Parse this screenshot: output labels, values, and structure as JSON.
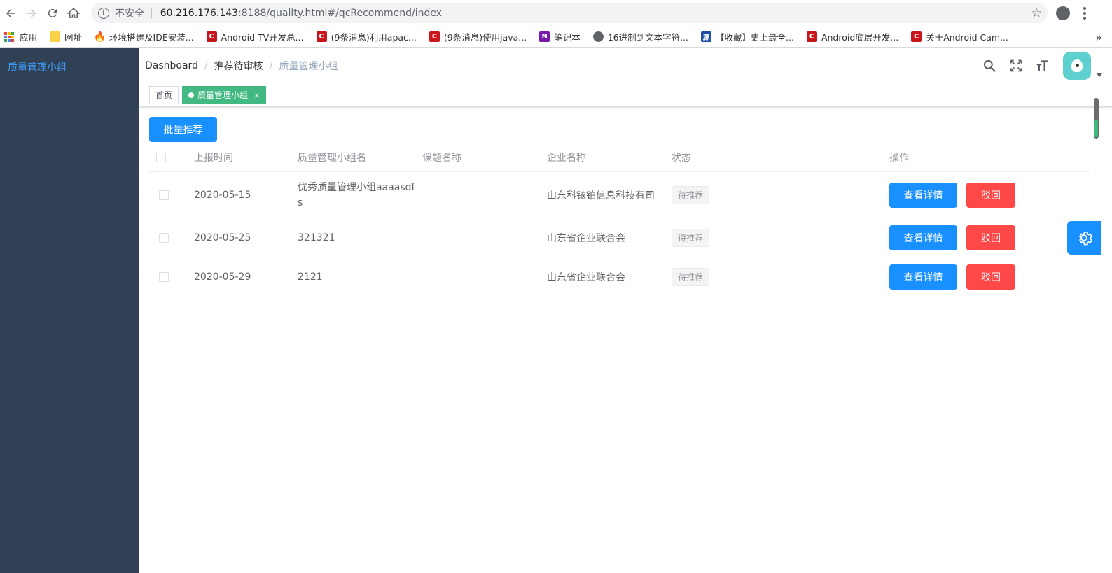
{
  "browser": {
    "insecure_label": "不安全",
    "url_host": "60.216.176.143",
    "url_path": ":8188/quality.html#/qcRecommend/index",
    "bookmarks": [
      {
        "label": "应用",
        "icon": "apps-grid-icon"
      },
      {
        "label": "网址",
        "icon": "folder-icon"
      },
      {
        "label": "环境搭建及IDE安装...",
        "icon": "fire-icon"
      },
      {
        "label": "Android TV开发总...",
        "icon": "csdn-icon"
      },
      {
        "label": "(9条消息)利用apac...",
        "icon": "csdn-icon"
      },
      {
        "label": "(9条消息)使用java...",
        "icon": "csdn-icon"
      },
      {
        "label": "笔记本",
        "icon": "onenote-icon"
      },
      {
        "label": "16进制到文本字符...",
        "icon": "globe-icon"
      },
      {
        "label": "【收藏】史上最全...",
        "icon": "source-icon"
      },
      {
        "label": "Android底层开发...",
        "icon": "csdn-icon"
      },
      {
        "label": "关于Android Cam...",
        "icon": "csdn-icon"
      }
    ],
    "bookmarks_more": "»"
  },
  "sidebar": {
    "items": [
      {
        "label": "质量管理小组"
      }
    ]
  },
  "navbar": {
    "breadcrumb": [
      "Dashboard",
      "推荐待审核",
      "质量管理小组"
    ],
    "breadcrumb_sep": "/"
  },
  "tags": {
    "items": [
      {
        "label": "首页",
        "active": false
      },
      {
        "label": "质量管理小组",
        "active": true
      }
    ],
    "close_glyph": "×"
  },
  "toolbar": {
    "batch_recommend_label": "批量推荐"
  },
  "table": {
    "columns": [
      "上报时间",
      "质量管理小组名",
      "课题名称",
      "企业名称",
      "状态",
      "操作"
    ],
    "rows": [
      {
        "date": "2020-05-15",
        "group": "优秀质量管理小组aaaasdfs",
        "topic": "",
        "company": "山东科铱铂信息科技有司",
        "status": "待推荐",
        "detail": "查看详情",
        "reject": "驳回"
      },
      {
        "date": "2020-05-25",
        "group": "321321",
        "topic": "",
        "company": "山东省企业联合会",
        "status": "待推荐",
        "detail": "查看详情",
        "reject": "驳回"
      },
      {
        "date": "2020-05-29",
        "group": "2121",
        "topic": "",
        "company": "山东省企业联合会",
        "status": "待推荐",
        "detail": "查看详情",
        "reject": "驳回"
      }
    ]
  },
  "colors": {
    "sidebar_bg": "#304156",
    "primary": "#1890ff",
    "danger": "#ff4949",
    "tag_active": "#42b983"
  }
}
